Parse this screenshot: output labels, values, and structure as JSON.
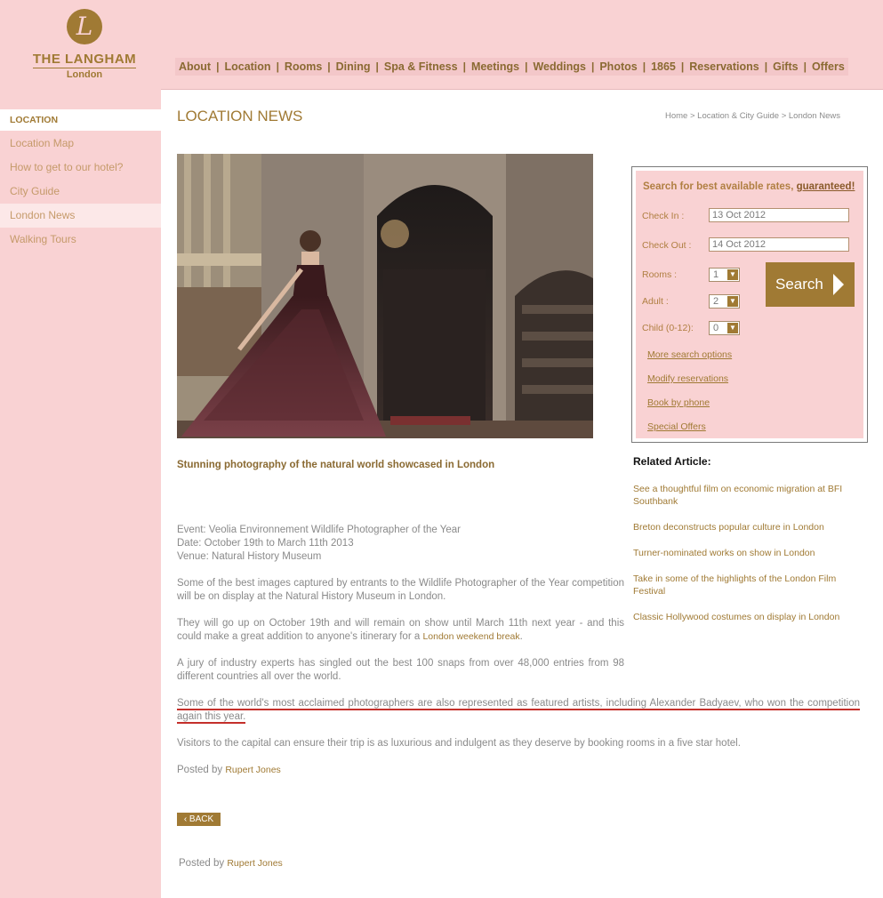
{
  "brand": {
    "mark": "L",
    "name": "THE LANGHAM",
    "city": "London"
  },
  "nav": [
    "About",
    "Location",
    "Rooms",
    "Dining",
    "Spa & Fitness",
    "Meetings",
    "Weddings",
    "Photos",
    "1865",
    "Reservations",
    "Gifts",
    "Offers"
  ],
  "sidebar": {
    "heading": "LOCATION",
    "items": [
      {
        "label": "Location Map",
        "active": false
      },
      {
        "label": "How to get to our hotel?",
        "active": false
      },
      {
        "label": "City Guide",
        "active": false
      },
      {
        "label": "London News",
        "active": true
      },
      {
        "label": "Walking Tours",
        "active": false
      }
    ]
  },
  "page": {
    "title": "LOCATION NEWS",
    "breadcrumb": "Home > Location & City Guide > London News"
  },
  "article": {
    "subtitle": "Stunning photography of the natural world showcased in London",
    "event": "Event: Veolia Environnement Wildlife Photographer of the Year",
    "date": "Date: October 19th to March 11th 2013",
    "venue": "Venue: Natural History Museum",
    "p1": "Some of the best images captured by entrants to the Wildlife Photographer of the Year competition will be on display at the Natural History Museum in London.",
    "p2_text": "They will go up on October 19th and will remain on show until March 11th next year - and this could make a great addition to anyone's itinerary for a ",
    "p2_link": "London weekend break",
    "p2_end": ".",
    "p3": "A jury of industry experts has singled out the best 100 snaps from over 48,000 entries from 98 different countries all over the world.",
    "p4": "Some of the world's most acclaimed photographers are also represented as featured artists, including Alexander Badyaev, who won the competition again this year.",
    "p5": "Visitors to the capital can ensure their trip is as luxurious and indulgent as they deserve by booking rooms in a five star hotel.",
    "posted_prefix": "Posted by ",
    "author": "Rupert Jones",
    "back_label": "‹ BACK"
  },
  "booking": {
    "title": "Search for best available rates,",
    "guaranteed": "guaranteed!",
    "checkin_label": "Check In :",
    "checkin_value": "13 Oct 2012",
    "checkout_label": "Check Out :",
    "checkout_value": "14 Oct 2012",
    "rooms_label": "Rooms :",
    "rooms_value": "1",
    "adult_label": "Adult :",
    "adult_value": "2",
    "child_label": "Child (0-12):",
    "child_value": "0",
    "search_label": "Search",
    "links": [
      "More search options",
      "Modify reservations",
      "Book by phone",
      "Special Offers"
    ]
  },
  "related": {
    "title": "Related Article:",
    "items": [
      "See a thoughtful film on economic migration at BFI Southbank",
      "Breton deconstructs popular culture in London",
      "Turner-nominated works on show in London",
      "Take in some of the highlights of the London Film Festival",
      "Classic Hollywood costumes on display in London"
    ]
  },
  "colors": {
    "pink": "#f9d2d3",
    "gold": "#a07a34",
    "text": "#8a8a8a",
    "underline": "#c4302b"
  }
}
